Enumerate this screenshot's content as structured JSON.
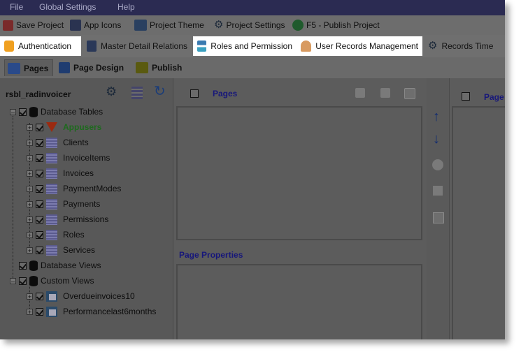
{
  "menu": [
    "File",
    "Global Settings",
    "Help"
  ],
  "toolbar": {
    "save_project": "Save Project",
    "app_icons": "App Icons",
    "project_theme": "Project Theme",
    "project_settings": "Project Settings",
    "publish": "F5 - Publish Project"
  },
  "tabs": {
    "authentication": "Authentication",
    "master_detail": "Master Detail Relations",
    "roles": "Roles and Permission",
    "user_records": "User Records Management",
    "records_time": "Records Time"
  },
  "subtabs": {
    "pages": "Pages",
    "page_design": "Page Design",
    "publish": "Publish"
  },
  "tree": {
    "project": "rsbl_radinvoicer",
    "database_tables": "Database Tables",
    "tables": [
      "Appusers",
      "Clients",
      "InvoiceItems",
      "Invoices",
      "PaymentModes",
      "Payments",
      "Permissions",
      "Roles",
      "Services"
    ],
    "database_views": "Database Views",
    "custom_views": "Custom Views",
    "views": [
      "Overdueinvoices10",
      "Performancelast6months"
    ]
  },
  "middle": {
    "pages_title": "Pages",
    "page_properties": "Page Properties"
  },
  "right": {
    "title": "Page"
  },
  "colors": {
    "highlight_tab": "#ffffff",
    "menu_bg": "#2b2b52",
    "appusers_text": "#1e6a1e"
  }
}
